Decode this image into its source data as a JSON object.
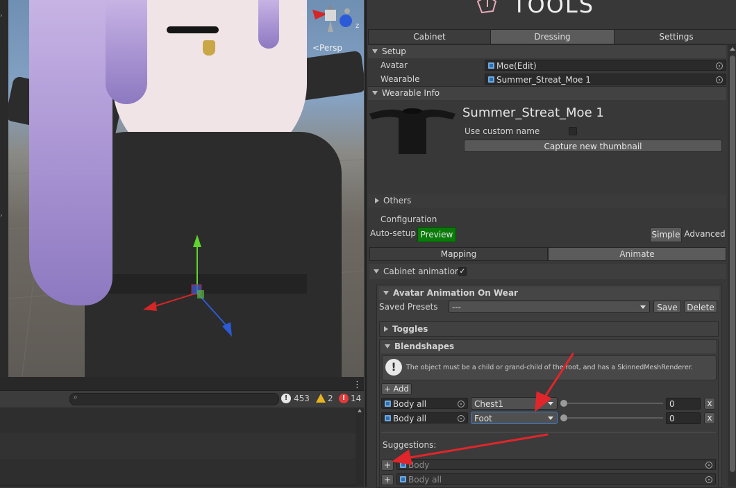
{
  "scene": {
    "gizmo_x": "x",
    "gizmo_z": "z",
    "persp_label": "<Persp"
  },
  "console": {
    "search_placeholder": "",
    "info_count": "453",
    "warn_count": "2",
    "error_count": "14"
  },
  "panel": {
    "title": "TOOLS",
    "tabs": [
      "Cabinet",
      "Dressing",
      "Settings"
    ],
    "setup": {
      "header": "Setup",
      "avatar_label": "Avatar",
      "avatar_value": "Moe(Edit)",
      "wearable_label": "Wearable",
      "wearable_value": "Summer_Streat_Moe 1"
    },
    "wearable_info": {
      "header": "Wearable Info",
      "name": "Summer_Streat_Moe 1",
      "custom_name_label": "Use custom name",
      "capture_button": "Capture new thumbnail"
    },
    "others_label": "Others",
    "configuration": {
      "label": "Configuration",
      "auto_setup": "Auto-setup",
      "preview": "Preview",
      "simple": "Simple",
      "advanced": "Advanced",
      "mapping_tab": "Mapping",
      "animate_tab": "Animate"
    },
    "cabinet_animation": {
      "label": "Cabinet animation",
      "checked": "✓"
    },
    "avatar_anim": {
      "header": "Avatar Animation On Wear",
      "saved_presets_label": "Saved Presets",
      "presets_value": "---",
      "save_button": "Save",
      "delete_button": "Delete"
    },
    "toggles_header": "Toggles",
    "blendshapes": {
      "header": "Blendshapes",
      "help_text": "The object must be a child or grand-child of the root, and has a SkinnedMeshRenderer.",
      "add_button": "+ Add",
      "rows": [
        {
          "object": "Body all",
          "shape": "Chest1",
          "value": "0",
          "remove": "x"
        },
        {
          "object": "Body all",
          "shape": "Foot",
          "value": "0",
          "remove": "x"
        }
      ]
    },
    "suggestions": {
      "label": "Suggestions:",
      "items": [
        {
          "add": "+",
          "object": "Body"
        },
        {
          "add": "+",
          "object": "Body all"
        }
      ]
    }
  },
  "colors": {
    "preview_green": "#0a7a0a",
    "annotation_red": "#e0262a",
    "selected_blue": "#3a7fd5"
  }
}
